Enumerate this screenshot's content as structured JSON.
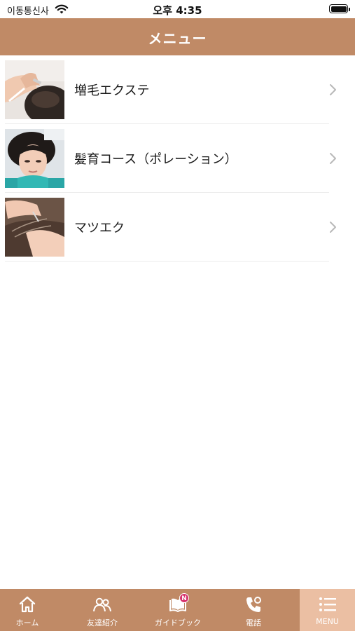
{
  "status_bar": {
    "carrier": "이동통신사",
    "time": "오후 4:35"
  },
  "header": {
    "title": "メニュー"
  },
  "menu": {
    "items": [
      {
        "label": "増毛エクステ",
        "thumbnail": "hair-extension-photo"
      },
      {
        "label": "髪育コース（ポレーション）",
        "thumbnail": "woman-face-photo"
      },
      {
        "label": "マツエク",
        "thumbnail": "hair-closeup-photo"
      }
    ]
  },
  "tab_bar": {
    "active_color": "#ebbfa3",
    "bar_color": "#c08a66",
    "badge": "N",
    "tabs": [
      {
        "label": "ホーム",
        "icon": "home-icon"
      },
      {
        "label": "友達紹介",
        "icon": "friends-icon"
      },
      {
        "label": "ガイドブック",
        "icon": "book-icon"
      },
      {
        "label": "電話",
        "icon": "phone-icon"
      },
      {
        "label": "MENU",
        "icon": "menu-list-icon"
      }
    ]
  }
}
